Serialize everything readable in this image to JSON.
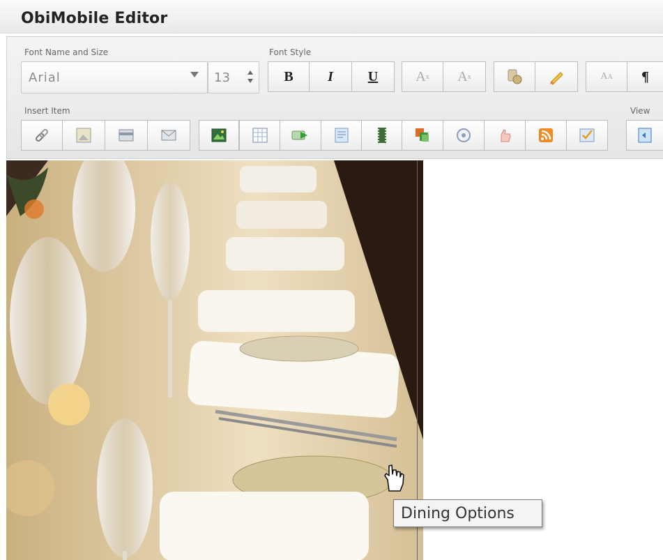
{
  "window": {
    "title": "ObiMobile Editor"
  },
  "toolbar": {
    "font_name_size_label": "Font Name and Size",
    "font_style_label": "Font Style",
    "insert_item_label": "Insert Item",
    "view_label": "View",
    "font_name_value": "Arial",
    "font_size_value": "13",
    "bold_label": "B",
    "italic_label": "I",
    "underline_label": "U",
    "subscript_label": "A",
    "superscript_label": "A",
    "font_size_adjust_label": "A",
    "paragraph_label": "¶"
  },
  "insert_icons": [
    "link-icon",
    "image-placeholder-icon",
    "banner-icon",
    "envelope-icon",
    "picture-icon",
    "table-icon",
    "arrow-button-icon",
    "form-icon",
    "video-icon",
    "gallery-icon",
    "clock-icon",
    "hand-icon",
    "rss-icon",
    "checklist-icon"
  ],
  "tooltip": {
    "text": "Dining Options"
  },
  "colors": {
    "accent_orange": "#f08a24",
    "toolbar_bg": "#ececec"
  }
}
